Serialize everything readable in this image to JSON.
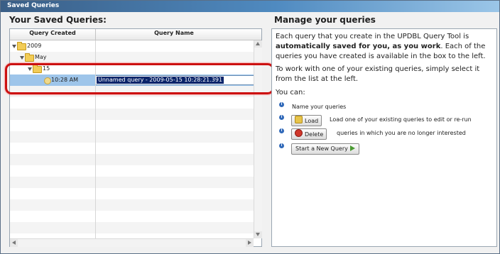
{
  "window": {
    "title": "Saved Queries"
  },
  "left": {
    "title": "Your Saved Queries:",
    "columns": [
      "Query Created",
      "Query Name"
    ],
    "tree": {
      "year": "2009",
      "month": "May",
      "day": "15",
      "time": "10:28 AM",
      "name_value": "Unnamed query - 2009-05-15 10:28:21.391"
    }
  },
  "right": {
    "title": "Manage your queries",
    "p1_plain": "Each query that you create in the UPDBL Query Tool is",
    "p1_bold": "automatically saved for you, as you work",
    "p1_rest": ". Each of the queries you have created is available in the box to the left.",
    "p2": "To work with one of your existing queries, simply select it from the list at the left.",
    "you_can": "You can:",
    "actions": [
      {
        "text": "Name your queries"
      },
      {
        "button": "Load",
        "text": "Load one of your existing queries to edit or re-run"
      },
      {
        "button": "Delete",
        "text": "queries in which you are no longer interested"
      },
      {
        "button": "Start a New Query",
        "text": ""
      }
    ]
  },
  "colors": {
    "accent": "#4f8ac0",
    "selection": "#9ec5ea",
    "highlight_ring": "#cc1111"
  }
}
